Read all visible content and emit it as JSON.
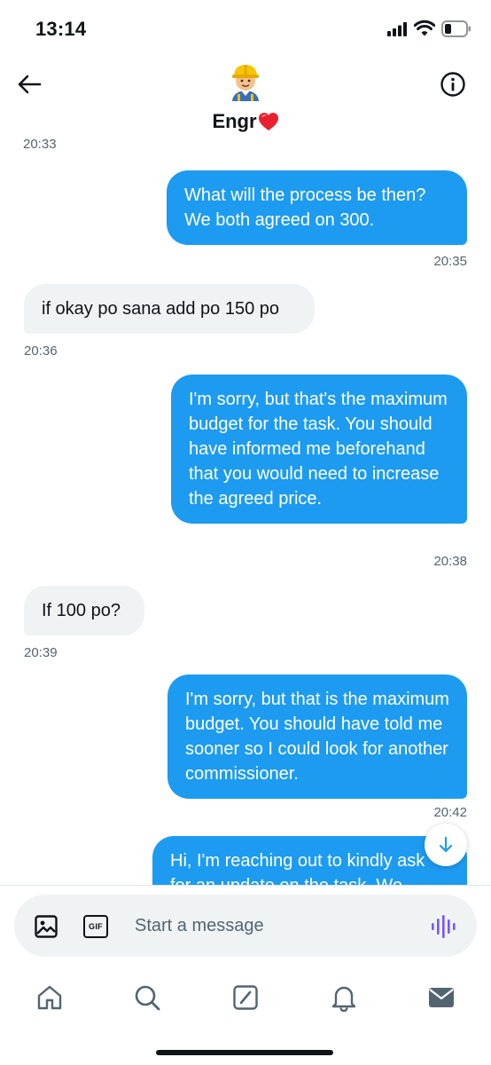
{
  "status_bar": {
    "time": "13:14"
  },
  "header": {
    "contact_name": "Engr",
    "contact_name_emoji": "red-heart-emoji",
    "avatar": "construction-worker-emoji"
  },
  "messages": [
    {
      "id": 0,
      "direction": "incoming",
      "text": "",
      "time": "20:33"
    },
    {
      "id": 1,
      "direction": "outgoing",
      "text": "What will the process be then? We both agreed on 300.",
      "time": "20:35"
    },
    {
      "id": 2,
      "direction": "incoming",
      "text": "if okay po sana add po 150 po",
      "time": "20:36"
    },
    {
      "id": 3,
      "direction": "outgoing",
      "text": "I'm sorry, but that's the maximum budget for the task. You should have informed me beforehand that you would need to increase the agreed price.",
      "time": "20:38"
    },
    {
      "id": 4,
      "direction": "incoming",
      "text": "If 100 po?",
      "time": "20:39"
    },
    {
      "id": 5,
      "direction": "outgoing",
      "text": "I'm sorry, but that is the maximum budget. You should have told me sooner so I could look for another commissioner.",
      "time": "20:42"
    },
    {
      "id": 6,
      "direction": "outgoing",
      "text": "Hi, I'm reaching out to kindly ask for an update on the task. We",
      "time": ""
    }
  ],
  "composer": {
    "placeholder": "Start a message",
    "gif_label": "GIF"
  },
  "tab_bar": [
    "home-icon",
    "search-icon",
    "grok-icon",
    "notifications-icon",
    "messages-icon"
  ],
  "colors": {
    "accent": "#1d9bf0",
    "incoming_bubble": "#eff3f4",
    "voice_icon": "#7856ff"
  }
}
